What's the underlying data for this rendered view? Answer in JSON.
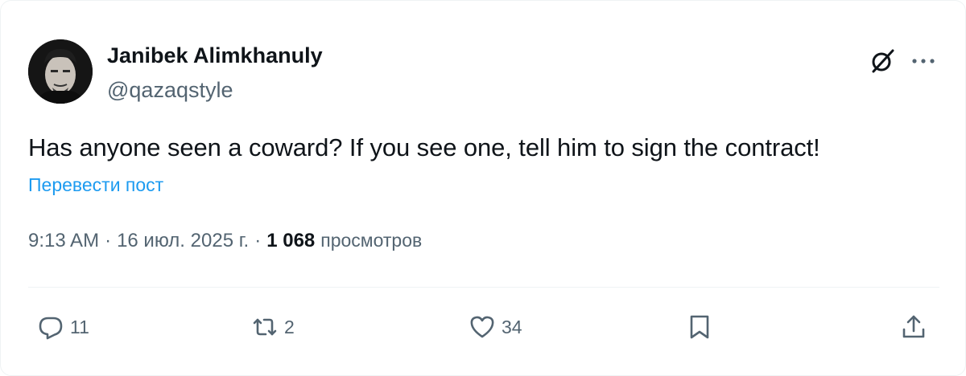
{
  "author": {
    "display_name": "Janibek Alimkhanuly",
    "handle": "@qazaqstyle"
  },
  "tweet": {
    "text": "Has anyone seen a coward? If you see one, tell him to sign the contract!",
    "translate_label": "Перевести пост"
  },
  "meta": {
    "time": "9:13 AM",
    "separator": "·",
    "date": "16 июл. 2025 г.",
    "views_count": "1 068",
    "views_label": "просмотров"
  },
  "actions": {
    "replies": "11",
    "reposts": "2",
    "likes": "34"
  },
  "colors": {
    "text_primary": "#0f1419",
    "text_secondary": "#536471",
    "link": "#1d9bf0",
    "divider": "#eff3f4"
  },
  "icons": [
    "grok-icon",
    "more-icon",
    "reply-icon",
    "repost-icon",
    "like-icon",
    "bookmark-icon",
    "share-icon"
  ]
}
